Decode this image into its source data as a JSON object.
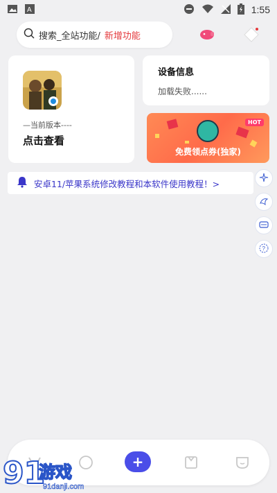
{
  "status_bar": {
    "time": "1:55"
  },
  "search": {
    "placeholder": "搜索_全站功能/",
    "accent": "新增功能"
  },
  "version_card": {
    "label": "—当前版本----",
    "title": "点击查看"
  },
  "device_card": {
    "title": "设备信息",
    "status": "加载失败......"
  },
  "promo_card": {
    "badge": "HOT",
    "text": "免费领点券(独家)"
  },
  "notice": {
    "text": "安卓11/苹果系统修改教程和本软件使用教程！>"
  },
  "bottom_nav": {
    "plus_label": "+"
  },
  "watermark": {
    "logo_text": "91游戏",
    "site": "91danji.com"
  },
  "colors": {
    "accent_red": "#e4393c",
    "notice_blue": "#3a36c9",
    "nav_plus": "#4a4ee8",
    "promo_orange": "#ff7a4f"
  }
}
